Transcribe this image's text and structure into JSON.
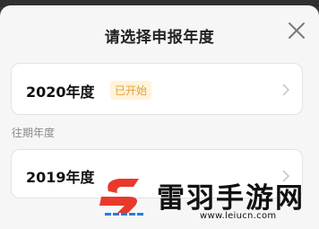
{
  "dialog": {
    "title": "请选择申报年度",
    "close_icon": "close-icon"
  },
  "current_year": {
    "label": "2020年度",
    "status": "已开始",
    "chevron_icon": "chevron-right-icon"
  },
  "past_section": {
    "heading": "往期年度",
    "items": [
      {
        "label": "2019年度",
        "chevron_icon": "chevron-right-icon"
      }
    ]
  },
  "watermark": {
    "name": "雷羽手游网",
    "url": "www.leiucn.com"
  },
  "colors": {
    "badge_text": "#e0a13a",
    "badge_bg": "#fff3d9",
    "logo_red": "#e8392b",
    "logo_blue": "#2a7bd8"
  }
}
